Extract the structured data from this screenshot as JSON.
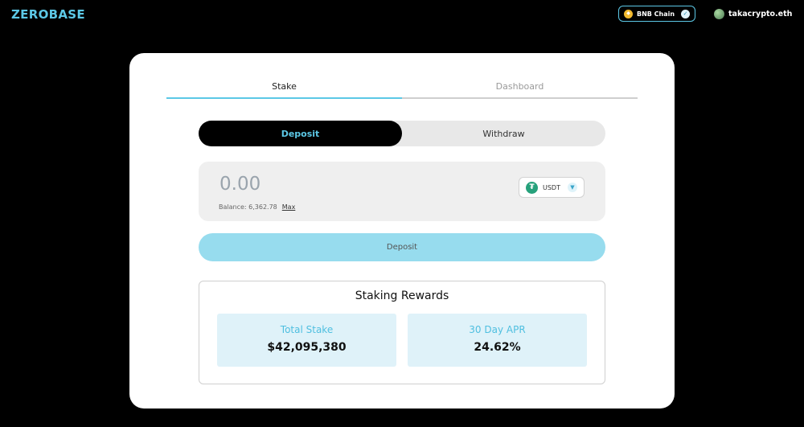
{
  "header": {
    "logo": "ZEROBASE",
    "chain": {
      "label": "BNB Chain",
      "icon": "bnb-icon",
      "status_icon": "check-icon"
    },
    "account": {
      "name": "takacrypto.eth",
      "icon": "avatar"
    }
  },
  "tabs": [
    {
      "label": "Stake",
      "active": true
    },
    {
      "label": "Dashboard",
      "active": false
    }
  ],
  "mode_toggle": {
    "options": [
      {
        "label": "Deposit",
        "active": true
      },
      {
        "label": "Withdraw",
        "active": false
      }
    ]
  },
  "amount": {
    "placeholder": "0.00",
    "value": "",
    "balance_label": "Balance: 6,362.78",
    "max_label": "Max",
    "token": {
      "symbol": "USDT",
      "icon": "usdt-icon",
      "icon_glyph": "₮"
    }
  },
  "submit": {
    "label": "Deposit"
  },
  "rewards": {
    "title": "Staking Rewards",
    "stats": [
      {
        "label": "Total Stake",
        "value": "$42,095,380"
      },
      {
        "label": "30 Day APR",
        "value": "24.62%"
      }
    ]
  },
  "colors": {
    "accent": "#5cc8e6",
    "button_fill": "#97dcee",
    "stat_bg": "#dff2f9",
    "usdt": "#26a17b",
    "bnb": "#f3ba2f"
  }
}
